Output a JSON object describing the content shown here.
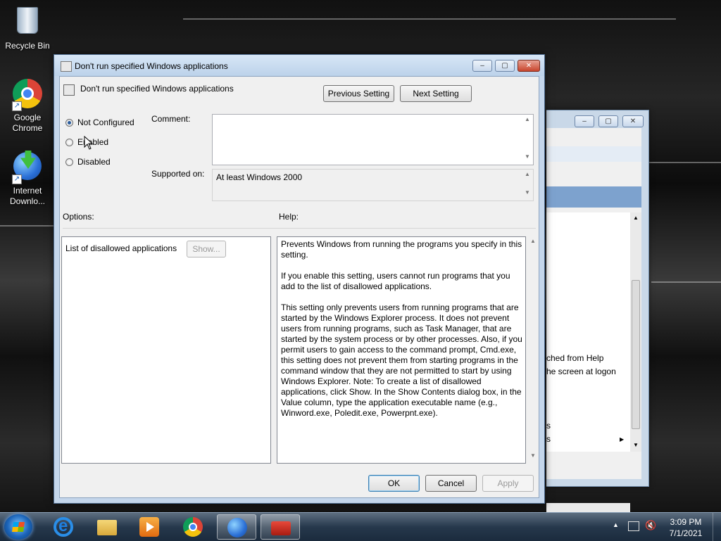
{
  "desktop": {
    "icons": [
      {
        "label_line1": "Recycle Bin",
        "label_line2": ""
      },
      {
        "label_line1": "Google",
        "label_line2": "Chrome"
      },
      {
        "label_line1": "Internet",
        "label_line2": "Downlo..."
      }
    ]
  },
  "background_window": {
    "lines": [
      "ched from Help",
      "he screen at logon",
      "s",
      "s"
    ]
  },
  "dialog": {
    "title": "Don't run specified Windows applications",
    "window_buttons": {
      "minimize": "‒",
      "maximize": "▢",
      "close": "✕"
    },
    "policy_name": "Don't run specified Windows applications",
    "previous_button": "Previous Setting",
    "next_button": "Next Setting",
    "state_options": {
      "not_configured": "Not Configured",
      "enabled": "Enabled",
      "disabled": "Disabled",
      "selected": "Not Configured"
    },
    "comment_label": "Comment:",
    "comment_value": "",
    "supported_label": "Supported on:",
    "supported_value": "At least Windows 2000",
    "options_label": "Options:",
    "help_label": "Help:",
    "options_row_label": "List of disallowed applications",
    "show_button": "Show...",
    "help_paragraphs": [
      "Prevents Windows from running the programs you specify in this setting.",
      "If you enable this setting, users cannot run programs that you add to the list of disallowed applications.",
      "This setting only prevents users from running programs that are started by the Windows Explorer process. It does not prevent users from running programs, such as Task Manager, that are started by the system process or by other processes. Also, if you permit users to gain access to the command prompt, Cmd.exe, this setting does not prevent them from starting programs in the command window that they are not permitted to start by using Windows Explorer. Note: To create a list of disallowed applications, click Show. In the Show Contents dialog box, in the Value column, type the application executable name (e.g., Winword.exe, Poledit.exe, Powerpnt.exe)."
    ],
    "ok_button": "OK",
    "cancel_button": "Cancel",
    "apply_button": "Apply"
  },
  "taskbar": {
    "pinned": [
      "internet-explorer-icon",
      "windows-explorer-icon",
      "media-player-icon",
      "chrome-icon",
      "internet-download-manager-icon",
      "toolbox-icon"
    ],
    "clock_time": "3:09 PM",
    "clock_date": "7/1/2021"
  }
}
